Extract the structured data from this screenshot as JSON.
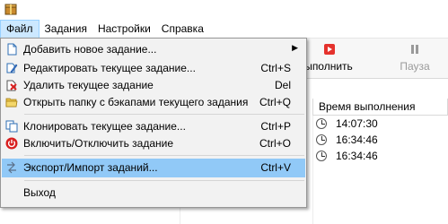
{
  "menubar": {
    "items": [
      {
        "label": "Файл",
        "active": true
      },
      {
        "label": "Задания"
      },
      {
        "label": "Настройки"
      },
      {
        "label": "Справка"
      }
    ]
  },
  "toolbar": {
    "run_label": "ыполнить",
    "pause_label": "Пауза"
  },
  "table": {
    "header_time": "Время выполнения",
    "rows": [
      {
        "time": "14:07:30"
      },
      {
        "time": "16:34:46"
      },
      {
        "time": "16:34:46"
      }
    ]
  },
  "file_menu": {
    "items": [
      {
        "label": "Добавить новое задание...",
        "shortcut": "",
        "icon": "new-task-icon",
        "submenu": true
      },
      {
        "label": "Редактировать текущее задание...",
        "shortcut": "Ctrl+S",
        "icon": "edit-icon"
      },
      {
        "label": "Удалить текущее задание",
        "shortcut": "Del",
        "icon": "delete-icon"
      },
      {
        "label": "Открыть папку с бэкапами текущего задания",
        "shortcut": "Ctrl+Q",
        "icon": "folder-icon"
      },
      {
        "label": "Клонировать текущее задание...",
        "shortcut": "Ctrl+P",
        "icon": "clone-icon"
      },
      {
        "label": "Включить/Отключить задание",
        "shortcut": "Ctrl+O",
        "icon": "power-icon"
      },
      {
        "label": "Экспорт/Импорт заданий...",
        "shortcut": "Ctrl+V",
        "icon": "export-import-icon",
        "highlighted": true
      },
      {
        "label": "Выход",
        "shortcut": "",
        "icon": ""
      }
    ]
  },
  "colors": {
    "highlight": "#91c9f7",
    "menu_bg": "#f2f2f2",
    "run_icon": "#e5322d",
    "pause_icon": "#9a9a9a"
  }
}
